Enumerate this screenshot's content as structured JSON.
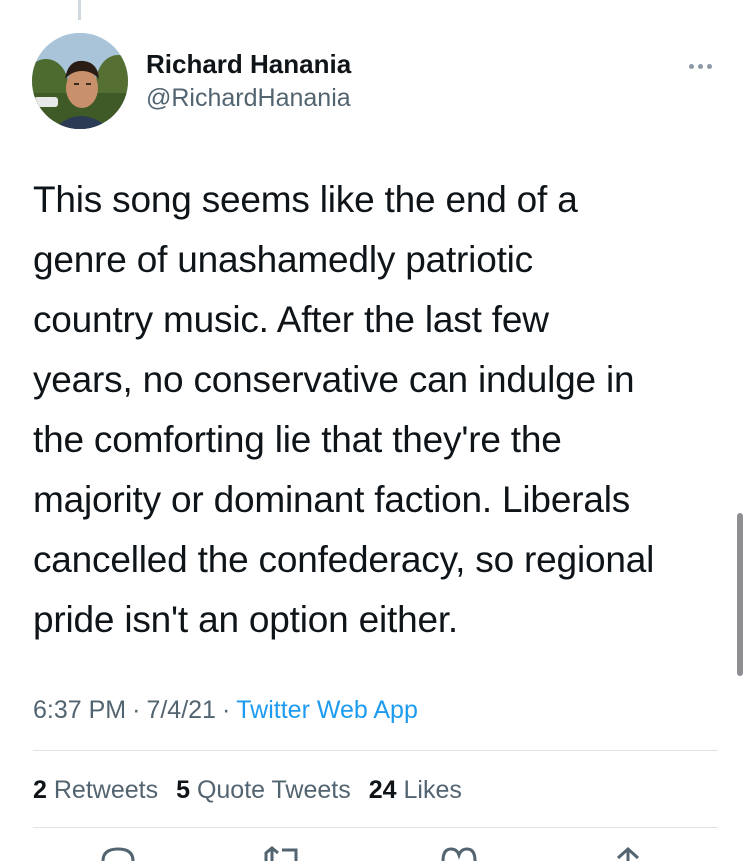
{
  "tweet": {
    "author": {
      "display_name": "Richard Hanania",
      "handle": "@RichardHanania"
    },
    "lines": [
      "This song seems like the end of a",
      "genre of unashamedly patriotic",
      "country music. After the last few",
      "years, no conservative can indulge in",
      "the comforting lie that they're the",
      "majority or dominant faction. Liberals",
      "cancelled the confederacy, so regional",
      "pride isn't an option either."
    ],
    "time": "6:37 PM",
    "date": "7/4/21",
    "separator": "·",
    "source": "Twitter Web App"
  },
  "stats": {
    "retweets_count": "2",
    "retweets_label": "Retweets",
    "quotes_count": "5",
    "quotes_label": "Quote Tweets",
    "likes_count": "24",
    "likes_label": "Likes"
  },
  "icons": {
    "more": "more-horizontal-icon",
    "reply": "reply-icon",
    "retweet": "retweet-icon",
    "like": "heart-icon",
    "share": "share-icon"
  },
  "colors": {
    "text": "#0f1419",
    "secondary": "#536471",
    "link": "#1d9bf0",
    "divider": "#dfe3e6"
  }
}
